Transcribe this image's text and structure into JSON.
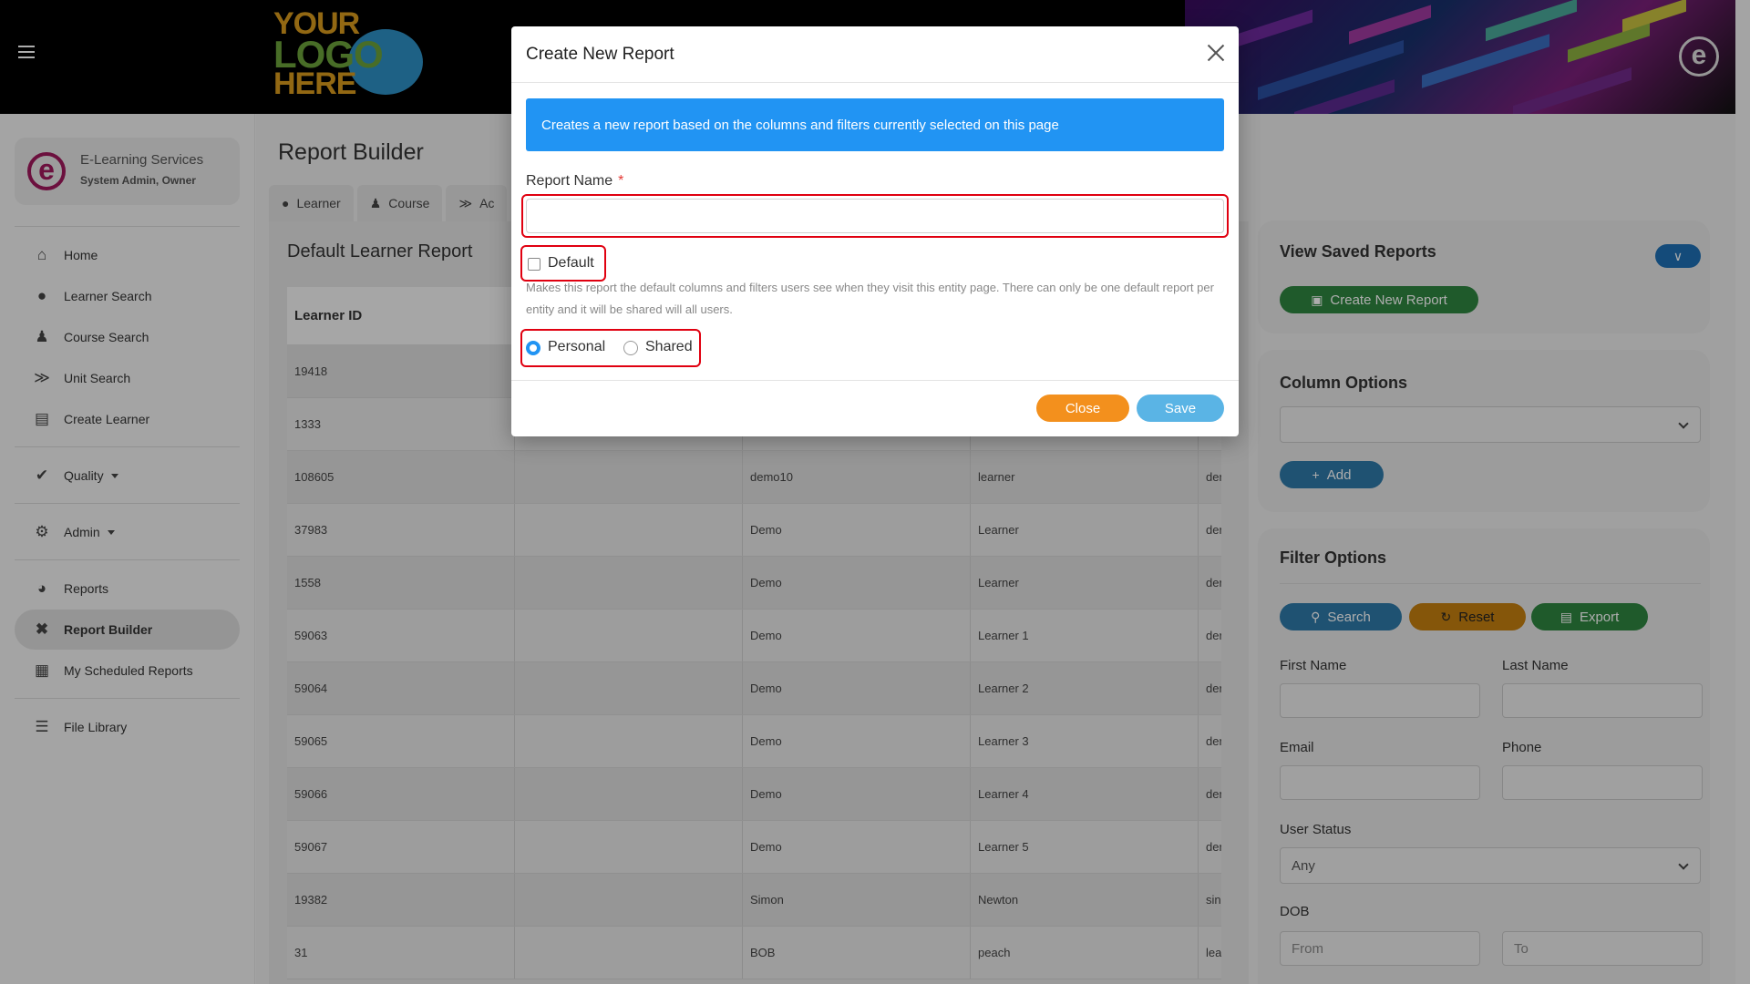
{
  "header": {
    "logo_line1": "YOUR",
    "logo_line2": "LOGO",
    "logo_line3": "HERE",
    "badge": "e"
  },
  "profile": {
    "org": "E-Learning Services",
    "role": "System Admin, Owner",
    "avatar": "e"
  },
  "nav": {
    "home": "Home",
    "learner_search": "Learner Search",
    "course_search": "Course Search",
    "unit_search": "Unit Search",
    "create_learner": "Create Learner",
    "quality": "Quality",
    "admin": "Admin",
    "reports": "Reports",
    "report_builder": "Report Builder",
    "scheduled_reports": "My Scheduled Reports",
    "file_library": "File Library"
  },
  "page": {
    "title": "Report Builder",
    "tabs": [
      "Learner",
      "Course",
      "Ac"
    ],
    "card_title": "Default Learner Report",
    "table_header": "Learner ID",
    "rows": [
      [
        "19418",
        "",
        "",
        "",
        ""
      ],
      [
        "1333",
        "",
        "",
        "",
        ""
      ],
      [
        "108605",
        "",
        "demo10",
        "learner",
        "der"
      ],
      [
        "37983",
        "",
        "Demo",
        "Learner",
        "der"
      ],
      [
        "1558",
        "",
        "Demo",
        "Learner",
        "der"
      ],
      [
        "59063",
        "",
        "Demo",
        "Learner 1",
        "der"
      ],
      [
        "59064",
        "",
        "Demo",
        "Learner 2",
        "der"
      ],
      [
        "59065",
        "",
        "Demo",
        "Learner 3",
        "der"
      ],
      [
        "59066",
        "",
        "Demo",
        "Learner 4",
        "der"
      ],
      [
        "59067",
        "",
        "Demo",
        "Learner 5",
        "der"
      ],
      [
        "19382",
        "",
        "Simon",
        "Newton",
        "sin"
      ],
      [
        "31",
        "",
        "BOB",
        "peach",
        "lea"
      ]
    ]
  },
  "saved_reports": {
    "title": "View Saved Reports",
    "create_button": "Create New Report"
  },
  "column_options": {
    "title": "Column Options",
    "select_value": "",
    "add_button": "Add"
  },
  "filter_options": {
    "title": "Filter Options",
    "search_button": "Search",
    "reset_button": "Reset",
    "export_button": "Export",
    "first_name_label": "First Name",
    "last_name_label": "Last Name",
    "email_label": "Email",
    "phone_label": "Phone",
    "user_status_label": "User Status",
    "user_status_value": "Any",
    "dob_label": "DOB",
    "dob_from_placeholder": "From",
    "dob_to_placeholder": "To"
  },
  "modal": {
    "title": "Create New Report",
    "info": "Creates a new report based on the columns and filters currently selected on this page",
    "name_label": "Report Name",
    "required_mark": "*",
    "name_value": "",
    "default_label": "Default",
    "default_help": "Makes this report the default columns and filters users see when they visit this entity page. There can only be one default report per entity and it will be shared will all users.",
    "personal_label": "Personal",
    "shared_label": "Shared",
    "close_button": "Close",
    "save_button": "Save"
  },
  "colors": {
    "info_blue": "#2194f3",
    "highlight_red": "#e00010",
    "close_orange": "#f3901d",
    "save_blue": "#5ab4e5",
    "green": "#2e8540",
    "steel_blue": "#2f79a8",
    "amber": "#c47f10"
  }
}
